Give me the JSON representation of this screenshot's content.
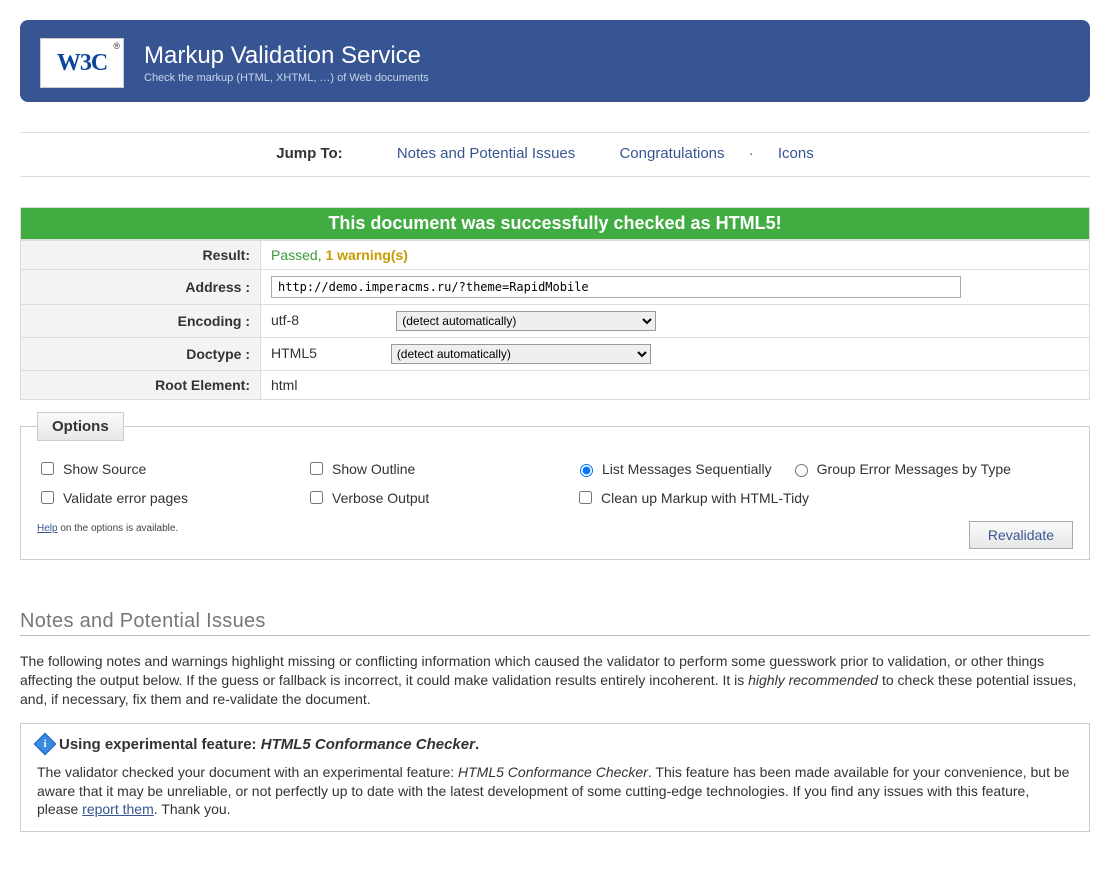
{
  "header": {
    "logo_text": "W3C",
    "title": "Markup Validation Service",
    "subtitle": "Check the markup (HTML, XHTML, …) of Web documents"
  },
  "jumpbar": {
    "label": "Jump To:",
    "link_notes": "Notes and Potential Issues",
    "link_congrats": "Congratulations",
    "link_icons": "Icons",
    "sep": "·"
  },
  "congrats": "This document was successfully checked as HTML5!",
  "table": {
    "result_label": "Result:",
    "result_passed": "Passed, ",
    "result_warning": "1 warning(s)",
    "address_label": "Address :",
    "address_value": "http://demo.imperacms.ru/?theme=RapidMobile",
    "encoding_label": "Encoding :",
    "encoding_value": "utf-8",
    "detect_option": "(detect automatically)",
    "doctype_label": "Doctype :",
    "doctype_value": "HTML5",
    "root_label": "Root Element:",
    "root_value": "html"
  },
  "options": {
    "legend": "Options",
    "show_source": "Show Source",
    "show_outline": "Show Outline",
    "list_seq": "List Messages Sequentially",
    "group_type": "Group Error Messages by Type",
    "validate_error": "Validate error pages",
    "verbose": "Verbose Output",
    "tidy": "Clean up Markup with HTML-Tidy",
    "revalidate": "Revalidate",
    "help_link": "Help",
    "help_text": " on the options is available."
  },
  "notes": {
    "heading": "Notes and Potential Issues",
    "intro_a": "The following notes and warnings highlight missing or conflicting information which caused the validator to perform some guesswork prior to validation, or other things affecting the output below. If the guess or fallback is incorrect, it could make validation results entirely incoherent. It is ",
    "intro_rec": "highly recommended",
    "intro_b": " to check these potential issues, and, if necessary, fix them and re-validate the document.",
    "box_head_a": "Using experimental feature: ",
    "box_head_b": "HTML5 Conformance Checker",
    "box_head_c": ".",
    "body_a": "The validator checked your document with an experimental feature: ",
    "body_b": "HTML5 Conformance Checker",
    "body_c": ". This feature has been made available for your convenience, but be aware that it may be unreliable, or not perfectly up to date with the latest development of some cutting-edge technologies. If you find any issues with this feature, please ",
    "body_link": "report them",
    "body_d": ". Thank you."
  }
}
